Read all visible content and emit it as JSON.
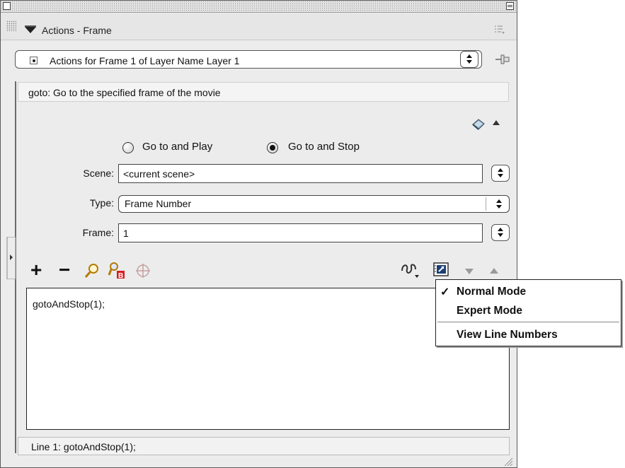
{
  "panel": {
    "title": "Actions - Frame",
    "frame_select": "Actions for Frame 1 of Layer Name Layer 1",
    "description": "goto: Go to the specified frame of the movie"
  },
  "options": {
    "radio_play": "Go to and Play",
    "radio_stop": "Go to and Stop",
    "selected": "Go to and Stop"
  },
  "fields": {
    "scene_label": "Scene:",
    "scene_value": "<current scene>",
    "type_label": "Type:",
    "type_value": "Frame Number",
    "frame_label": "Frame:",
    "frame_value": "1"
  },
  "toolbar": {
    "add": "+",
    "remove": "−"
  },
  "editor": {
    "code": "gotoAndStop(1);"
  },
  "status": {
    "text": "Line 1: gotoAndStop(1);"
  },
  "menu": {
    "items": [
      {
        "label": "Normal Mode",
        "checked": true
      },
      {
        "label": "Expert Mode",
        "checked": false
      },
      {
        "label": "View Line Numbers",
        "checked": false
      }
    ],
    "check_glyph": "✓"
  },
  "icons": [
    "disclosure-triangle-icon",
    "panel-options-icon",
    "pin-icon",
    "reference-book-icon",
    "collapse-up-icon",
    "find-icon",
    "replace-icon",
    "target-icon",
    "debug-options-icon",
    "view-options-icon",
    "move-down-icon",
    "move-up-icon",
    "resize-grip-icon"
  ]
}
